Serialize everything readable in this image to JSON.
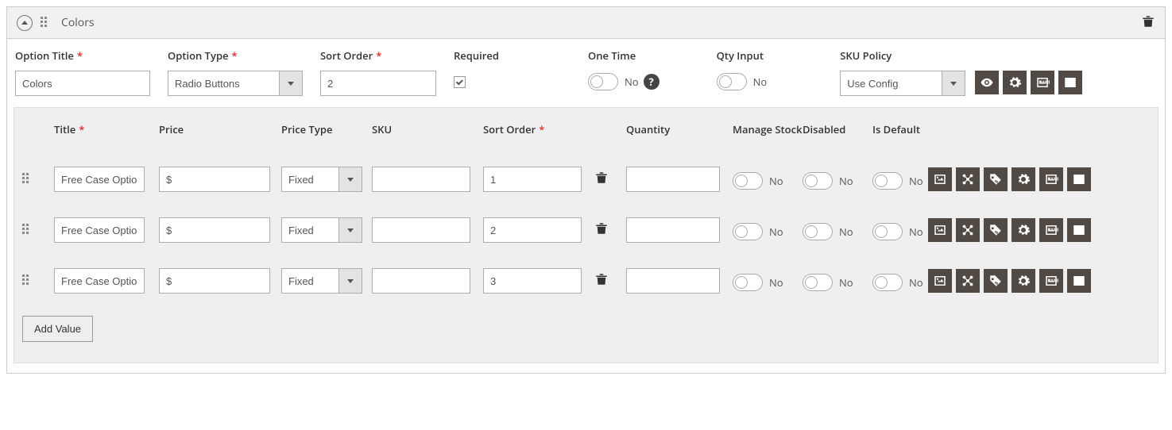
{
  "header": {
    "title": "Colors"
  },
  "option": {
    "labels": {
      "title": "Option Title",
      "type": "Option Type",
      "sort": "Sort Order",
      "required": "Required",
      "onetime": "One Time",
      "qtyinput": "Qty Input",
      "skupolicy": "SKU Policy"
    },
    "title": "Colors",
    "type": "Radio Buttons",
    "sort": "2",
    "required": true,
    "onetime": "No",
    "qtyinput": "No",
    "skupolicy": "Use Config"
  },
  "columns": {
    "title": "Title",
    "price": "Price",
    "ptype": "Price Type",
    "sku": "SKU",
    "sort": "Sort Order",
    "qty": "Quantity",
    "mstock": "Manage Stock",
    "disabled": "Disabled",
    "isdefault": "Is Default"
  },
  "rows": [
    {
      "title": "Free Case Option",
      "price": "$",
      "ptype": "Fixed",
      "sku": "",
      "sort": "1",
      "qty": "",
      "mstock": "No",
      "disabled": "No",
      "isdefault": "No"
    },
    {
      "title": "Free Case Option",
      "price": "$",
      "ptype": "Fixed",
      "sku": "",
      "sort": "2",
      "qty": "",
      "mstock": "No",
      "disabled": "No",
      "isdefault": "No"
    },
    {
      "title": "Free Case Option",
      "price": "$",
      "ptype": "Fixed",
      "sku": "",
      "sort": "3",
      "qty": "",
      "mstock": "No",
      "disabled": "No",
      "isdefault": "No"
    }
  ],
  "buttons": {
    "addvalue": "Add Value"
  }
}
